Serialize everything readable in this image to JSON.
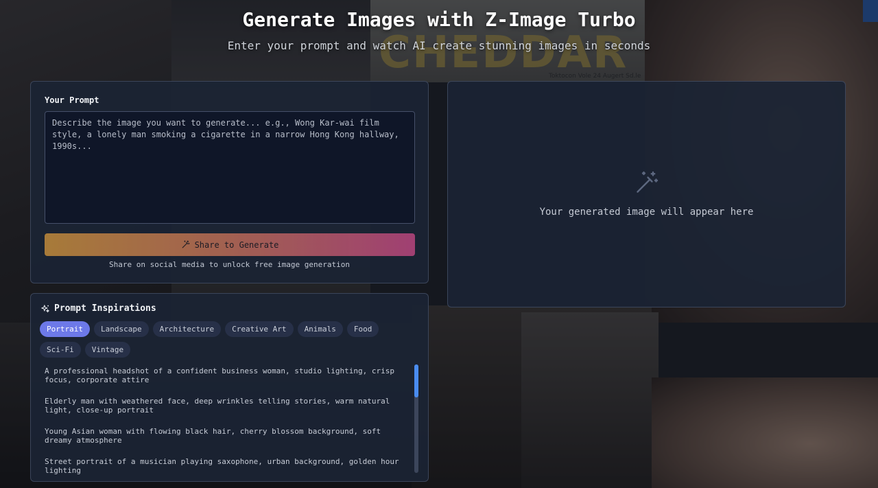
{
  "hero": {
    "title": "Generate Images with Z-Image Turbo",
    "subtitle": "Enter your prompt and watch AI create stunning images in seconds"
  },
  "background": {
    "poster_text": "CHEDDAR",
    "poster_subtext": "Toktocon Vole 24 Augert Sd.le"
  },
  "prompt_panel": {
    "label": "Your Prompt",
    "placeholder": "Describe the image you want to generate... e.g., Wong Kar-wai film style, a lonely man smoking a cigarette in a narrow Hong Kong hallway, 1990s...",
    "value": "",
    "generate_button": {
      "label": "Share to Generate",
      "icon": "magic-wand-icon"
    },
    "share_hint": "Share on social media to unlock free image generation"
  },
  "result_panel": {
    "icon": "magic-wand-icon",
    "placeholder_text": "Your generated image will appear here"
  },
  "inspirations": {
    "title": "Prompt Inspirations",
    "icon": "sparkles-icon",
    "tabs": [
      {
        "label": "Portrait",
        "active": true
      },
      {
        "label": "Landscape",
        "active": false
      },
      {
        "label": "Architecture",
        "active": false
      },
      {
        "label": "Creative Art",
        "active": false
      },
      {
        "label": "Animals",
        "active": false
      },
      {
        "label": "Food",
        "active": false
      },
      {
        "label": "Sci-Fi",
        "active": false
      },
      {
        "label": "Vintage",
        "active": false
      }
    ],
    "items": [
      "A professional headshot of a confident business woman, studio lighting, crisp focus, corporate attire",
      "Elderly man with weathered face, deep wrinkles telling stories, warm natural light, close-up portrait",
      "Young Asian woman with flowing black hair, cherry blossom background, soft dreamy atmosphere",
      "Street portrait of a musician playing saxophone, urban background, golden hour lighting"
    ]
  },
  "colors": {
    "accent": "#6d79e8",
    "button_gradient_start": "#c08a3a",
    "button_gradient_end": "#b8457e",
    "panel_bg": "#1b2334",
    "scroll_thumb": "#4a8cf0"
  }
}
